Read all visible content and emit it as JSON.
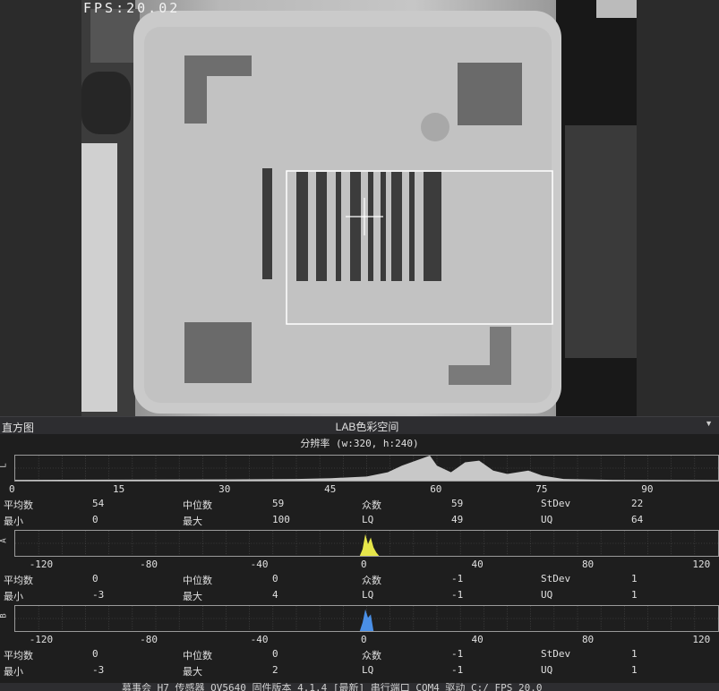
{
  "viewport": {
    "fps_overlay": "FPS:20.02"
  },
  "panel": {
    "title": "直方图",
    "colorspace": "LAB色彩空间",
    "resolution": "分辨率 (w:320, h:240)"
  },
  "histograms": [
    {
      "channel": "L",
      "color": "#c8c8c8",
      "range": [
        0,
        100
      ],
      "ticks": [
        "0",
        "15",
        "30",
        "45",
        "60",
        "75",
        "90"
      ],
      "tick_values": [
        0,
        15,
        30,
        45,
        60,
        75,
        90
      ],
      "stats": {
        "mean_label": "平均数",
        "mean": "54",
        "median_label": "中位数",
        "median": "59",
        "mode_label": "众数",
        "mode": "59",
        "stdev_label": "StDev",
        "stdev": "22",
        "min_label": "最小",
        "min": "0",
        "max_label": "最大",
        "max": "100",
        "lq_label": "LQ",
        "lq": "49",
        "uq_label": "UQ",
        "uq": "64"
      }
    },
    {
      "channel": "A",
      "color": "#e6e64a",
      "range": [
        -128,
        127
      ],
      "ticks": [
        "-120",
        "-80",
        "-40",
        "0",
        "40",
        "80",
        "120"
      ],
      "tick_values": [
        -120,
        -80,
        -40,
        0,
        40,
        80,
        120
      ],
      "stats": {
        "mean_label": "平均数",
        "mean": "0",
        "median_label": "中位数",
        "median": "0",
        "mode_label": "众数",
        "mode": "-1",
        "stdev_label": "StDev",
        "stdev": "1",
        "min_label": "最小",
        "min": "-3",
        "max_label": "最大",
        "max": "4",
        "lq_label": "LQ",
        "lq": "-1",
        "uq_label": "UQ",
        "uq": "1"
      }
    },
    {
      "channel": "B",
      "color": "#4a8fe6",
      "range": [
        -128,
        127
      ],
      "ticks": [
        "-120",
        "-80",
        "-40",
        "0",
        "40",
        "80",
        "120"
      ],
      "tick_values": [
        -120,
        -80,
        -40,
        0,
        40,
        80,
        120
      ],
      "stats": {
        "mean_label": "平均数",
        "mean": "0",
        "median_label": "中位数",
        "median": "0",
        "mode_label": "众数",
        "mode": "-1",
        "stdev_label": "StDev",
        "stdev": "1",
        "min_label": "最小",
        "min": "-3",
        "max_label": "最大",
        "max": "2",
        "lq_label": "LQ",
        "lq": "-1",
        "uq_label": "UQ",
        "uq": "1"
      }
    }
  ],
  "statusbar": {
    "text": "募事会 H7 传感器 OV5640 固件版本 4.1.4 [最新] 串行端口 COM4 驱动 C:/ FPS 20.0"
  }
}
